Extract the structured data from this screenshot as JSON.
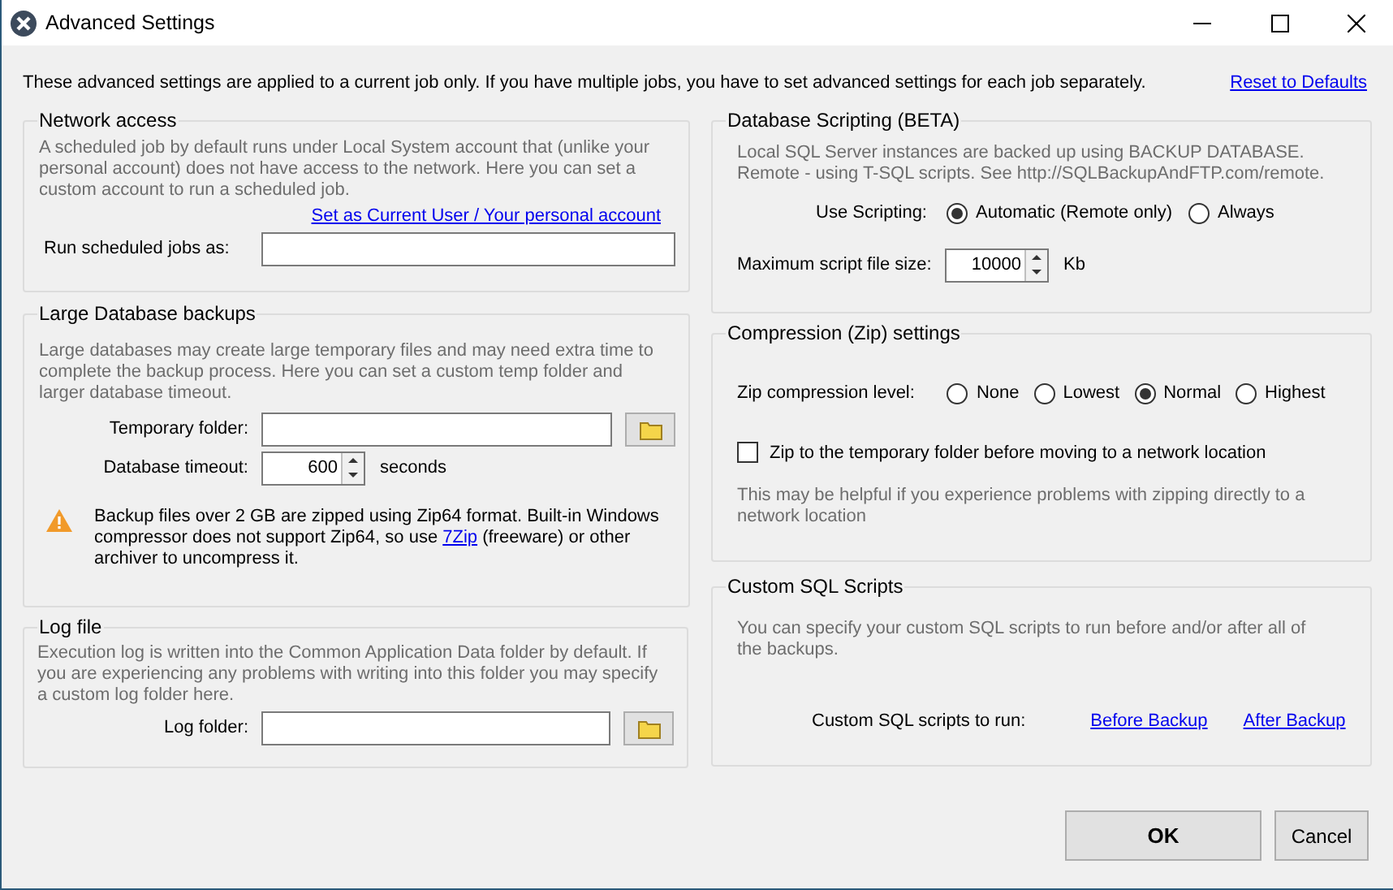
{
  "window": {
    "title": "Advanced Settings"
  },
  "intro": "These advanced settings are applied to a current job only. If you have multiple jobs, you have to set advanced settings for each job separately.",
  "reset_link": "Reset to Defaults",
  "network_access": {
    "title": "Network access",
    "description": "A scheduled job by default runs under Local System account that (unlike your personal account) does not have access to the network. Here you can set a custom account to run a scheduled job.",
    "link": "Set as Current User / Your personal account",
    "run_as_label": "Run scheduled jobs as:"
  },
  "large_backups": {
    "title": "Large Database backups",
    "description": "Large databases may create large temporary files and may need extra time to complete the backup process. Here you can set a custom temp folder and larger database timeout.",
    "temp_folder_label": "Temporary folder:",
    "timeout_label": "Database timeout:",
    "timeout_value": "600",
    "timeout_unit": "seconds",
    "warning_before": "Backup files over 2 GB are zipped using Zip64 format. Built-in Windows compressor does not support Zip64, so use ",
    "warning_link": "7Zip",
    "warning_after": " (freeware) or other archiver to uncompress it."
  },
  "log_file": {
    "title": "Log file",
    "description": "Execution log is written into the Common Application Data folder by default. If you are experiencing any problems with writing into this folder you may specify a custom log folder here.",
    "folder_label": "Log folder:"
  },
  "scripting": {
    "title": "Database Scripting (BETA)",
    "description": "Local SQL Server instances are backed up using BACKUP DATABASE. Remote - using T-SQL scripts. See http://SQLBackupAndFTP.com/remote.",
    "use_label": "Use Scripting:",
    "options": [
      {
        "label": "Automatic (Remote only)",
        "selected": true
      },
      {
        "label": "Always",
        "selected": false
      }
    ],
    "max_size_label": "Maximum script file size:",
    "max_size_value": "10000",
    "max_size_unit": "Kb"
  },
  "compression": {
    "title": "Compression (Zip) settings",
    "level_label": "Zip compression level:",
    "levels": [
      {
        "label": "None",
        "selected": false
      },
      {
        "label": "Lowest",
        "selected": false
      },
      {
        "label": "Normal",
        "selected": true
      },
      {
        "label": "Highest",
        "selected": false
      }
    ],
    "zip_temp": {
      "label": "Zip to the temporary folder before moving to a network location",
      "checked": false
    },
    "note": "This may be helpful if you experience problems with zipping directly to a network location"
  },
  "custom_sql": {
    "title": "Custom SQL Scripts",
    "description": "You can specify your custom SQL scripts to run before and/or after all of the backups.",
    "run_label": "Custom SQL scripts to run:",
    "links": [
      "Before Backup",
      "After Backup"
    ]
  },
  "buttons": {
    "ok": "OK",
    "cancel": "Cancel"
  }
}
